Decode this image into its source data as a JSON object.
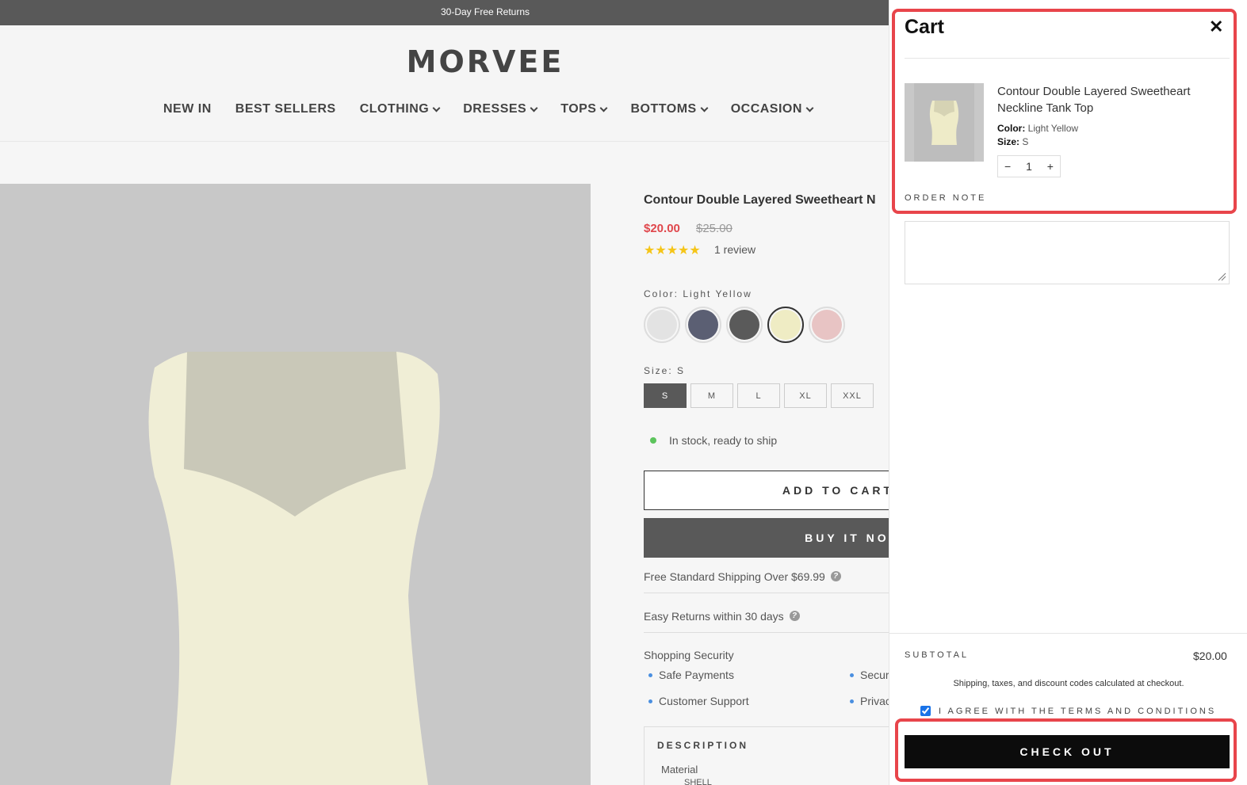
{
  "announcement": "30-Day Free Returns",
  "brand": "MORVEE",
  "nav": [
    {
      "label": "NEW IN",
      "dropdown": false
    },
    {
      "label": "BEST SELLERS",
      "dropdown": false
    },
    {
      "label": "CLOTHING",
      "dropdown": true
    },
    {
      "label": "DRESSES",
      "dropdown": true
    },
    {
      "label": "TOPS",
      "dropdown": true
    },
    {
      "label": "BOTTOMS",
      "dropdown": true
    },
    {
      "label": "OCCASION",
      "dropdown": true
    }
  ],
  "product": {
    "title": "Contour Double Layered Sweetheart N",
    "price": "$20.00",
    "compare_price": "$25.00",
    "stars": "★★★★★",
    "reviews": "1 review",
    "color_label": "Color: Light Yellow",
    "swatch_colors": [
      "#e3e3e3",
      "#5b5f73",
      "#5a5a5a",
      "#efecc4",
      "#e8c4c4"
    ],
    "size_label": "Size: S",
    "sizes": [
      "S",
      "M",
      "L",
      "XL",
      "XXL"
    ],
    "stock": "In stock, ready to ship",
    "add_to_cart": "ADD TO CART",
    "buy_now": "BUY IT NOW",
    "shipping": "Free Standard Shipping Over $69.99",
    "returns": "Easy Returns within 30 days",
    "security_title": "Shopping Security",
    "security_items": [
      "Safe Payments",
      "Secur",
      "Customer Support",
      "Privac"
    ],
    "description_title": "DESCRIPTION",
    "material_label": "Material",
    "shell_label": "SHELL"
  },
  "cart": {
    "title": "Cart",
    "close": "✕",
    "item": {
      "name": "Contour Double Layered Sweetheart Neckline Tank Top",
      "color_key": "Color:",
      "color_val": "Light Yellow",
      "size_key": "Size:",
      "size_val": "S",
      "qty": "1",
      "minus": "−",
      "plus": "+"
    },
    "order_note": "ORDER NOTE",
    "subtotal_label": "SUBTOTAL",
    "subtotal_value": "$20.00",
    "tax_note": "Shipping, taxes, and discount codes calculated at checkout.",
    "terms": "I AGREE WITH THE TERMS AND CONDITIONS",
    "checkout": "CHECK OUT"
  },
  "colors": {
    "accent_red": "#e8454b",
    "price_red": "#e0474c",
    "checkout_black": "#0c0c0c"
  }
}
